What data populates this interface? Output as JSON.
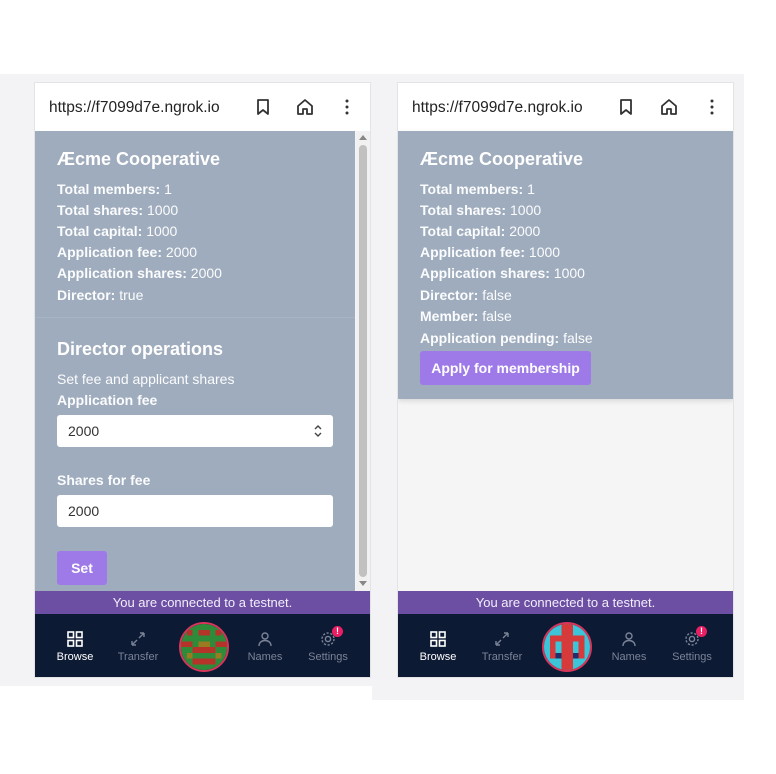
{
  "left": {
    "url": "https://f7099d7e.ngrok.io",
    "title": "Æcme Cooperative",
    "rows": [
      {
        "label": "Total members:",
        "value": " 1"
      },
      {
        "label": "Total shares:",
        "value": " 1000"
      },
      {
        "label": "Total capital:",
        "value": " 1000"
      },
      {
        "label": "Application fee:",
        "value": " 2000"
      },
      {
        "label": "Application shares:",
        "value": " 2000"
      },
      {
        "label": "Director:",
        "value": " true"
      }
    ],
    "director": {
      "heading": "Director operations",
      "subtitle": "Set fee and applicant shares",
      "fee_label": "Application fee",
      "fee_value": "2000",
      "shares_label": "Shares for fee",
      "shares_value": "2000",
      "set_button": "Set"
    }
  },
  "right": {
    "url": "https://f7099d7e.ngrok.io",
    "title": "Æcme Cooperative",
    "rows": [
      {
        "label": "Total members:",
        "value": " 1"
      },
      {
        "label": "Total shares:",
        "value": " 1000"
      },
      {
        "label": "Total capital:",
        "value": " 2000"
      },
      {
        "label": "Application fee:",
        "value": " 1000"
      },
      {
        "label": "Application shares:",
        "value": " 1000"
      },
      {
        "label": "Director:",
        "value": " false"
      },
      {
        "label": "Member:",
        "value": " false"
      },
      {
        "label": "Application pending:",
        "value": " false"
      }
    ],
    "apply_button": "Apply for membership"
  },
  "banner": "You are connected to a testnet.",
  "nav": {
    "browse": "Browse",
    "transfer": "Transfer",
    "names": "Names",
    "settings": "Settings",
    "settings_badge": "!"
  },
  "icons": [
    "bookmark-icon",
    "home-icon",
    "more-vert-icon",
    "grid-icon",
    "transfer-icon",
    "person-icon",
    "gear-icon"
  ],
  "colors": {
    "card": "#9facbd",
    "accent": "#9e79e8",
    "banner": "#6c4fa3",
    "nav": "#0d1a33",
    "badge": "#e91e63"
  }
}
